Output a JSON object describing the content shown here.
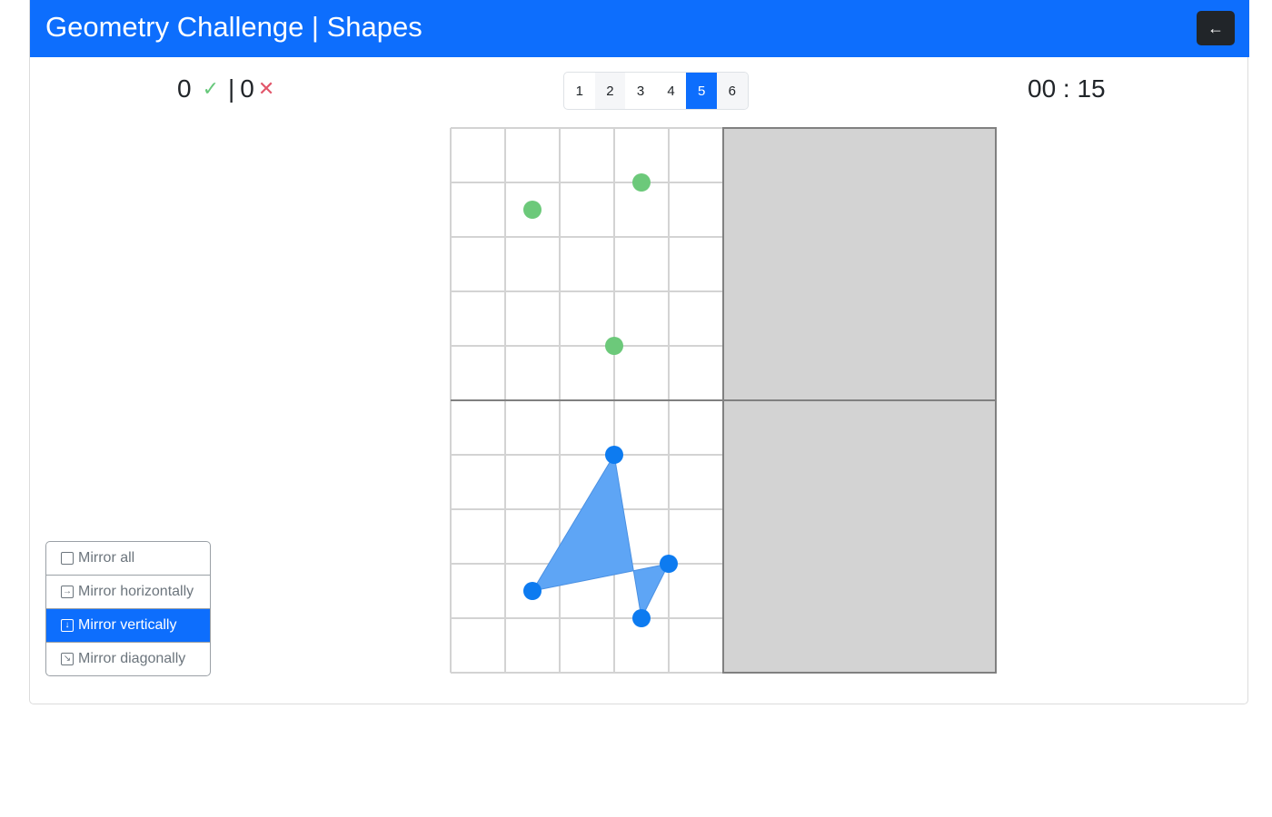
{
  "header": {
    "title": "Geometry Challenge | Shapes",
    "back_label": "←",
    "background": "#0d6efd"
  },
  "score": {
    "correct": "0",
    "correct_icon": "✓",
    "separator": "|",
    "wrong": "0",
    "wrong_icon": "✕"
  },
  "pagination": {
    "pages": [
      "1",
      "2",
      "3",
      "4",
      "5",
      "6"
    ],
    "active_page": "5"
  },
  "timer": {
    "text": "00 : 15"
  },
  "board": {
    "columns": 10,
    "rows": 10,
    "hidden_region_color": "#d3d3d3",
    "shape_fill": "#5ea5f5",
    "vertex_color": "#0d7bf0",
    "point_color": "#6cc97a",
    "green_points": [
      [
        1.5,
        1.5
      ],
      [
        3.5,
        1.0
      ],
      [
        3.0,
        4.0
      ]
    ],
    "shape_vertices": [
      [
        3,
        6
      ],
      [
        1.5,
        8.5
      ],
      [
        4,
        8
      ],
      [
        3.5,
        9
      ]
    ]
  },
  "mirror_options": [
    {
      "label": "Mirror all",
      "icon": "checkbox-icon",
      "active": false
    },
    {
      "label": "Mirror horizontally",
      "icon": "arrow-right-box-icon",
      "active": false
    },
    {
      "label": "Mirror vertically",
      "icon": "arrow-down-box-icon",
      "active": true
    },
    {
      "label": "Mirror diagonally",
      "icon": "arrow-diagonal-box-icon",
      "active": false
    }
  ]
}
